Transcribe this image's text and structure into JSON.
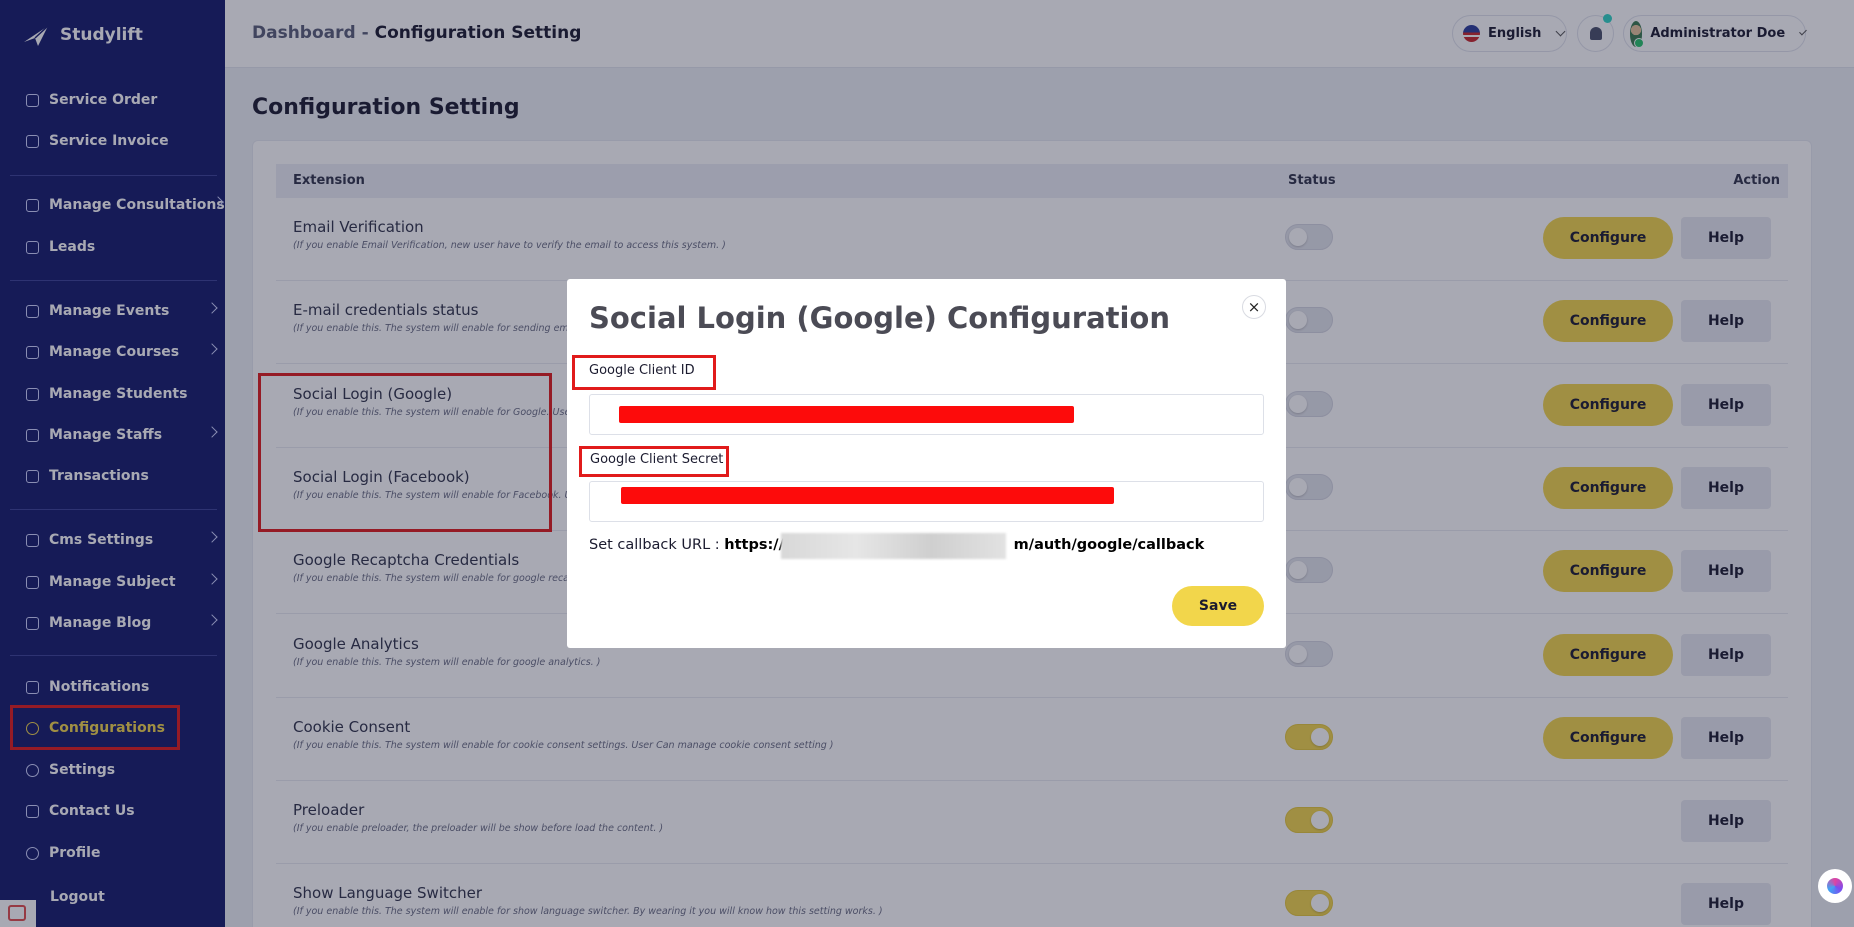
{
  "brand": {
    "name": "Studylift"
  },
  "sidebar": {
    "items": [
      {
        "label": "Service Order",
        "icon": "list-icon"
      },
      {
        "label": "Service Invoice",
        "icon": "invoice-icon"
      },
      {
        "label": "Manage Consultations",
        "icon": "consultation-icon"
      },
      {
        "label": "Leads",
        "icon": "leads-icon"
      },
      {
        "label": "Manage Events",
        "icon": "calendar-icon"
      },
      {
        "label": "Manage Courses",
        "icon": "course-icon"
      },
      {
        "label": "Manage Students",
        "icon": "students-icon"
      },
      {
        "label": "Manage Staffs",
        "icon": "staff-icon"
      },
      {
        "label": "Transactions",
        "icon": "transactions-icon"
      },
      {
        "label": "Cms Settings",
        "icon": "cms-icon"
      },
      {
        "label": "Manage Subject",
        "icon": "subject-icon"
      },
      {
        "label": "Manage Blog",
        "icon": "blog-icon"
      },
      {
        "label": "Notifications",
        "icon": "bell-icon"
      },
      {
        "label": "Configurations",
        "icon": "config-icon"
      },
      {
        "label": "Settings",
        "icon": "gear-icon"
      },
      {
        "label": "Contact Us",
        "icon": "contact-icon"
      },
      {
        "label": "Profile",
        "icon": "user-icon"
      },
      {
        "label": "Logout",
        "icon": "logout-icon"
      }
    ]
  },
  "topbar": {
    "breadcrumb_root": "Dashboard",
    "breadcrumb_sep": "-",
    "breadcrumb_current": "Configuration Setting",
    "language": "English",
    "user_name": "Administrator Doe"
  },
  "page": {
    "title": "Configuration Setting"
  },
  "table": {
    "columns": {
      "extension": "Extension",
      "status": "Status",
      "action": "Action"
    },
    "configure_label": "Configure",
    "help_label": "Help",
    "rows": [
      {
        "title": "Email Verification",
        "desc": "(If you enable Email Verification, new user have to verify the email to access this system. )",
        "status": false,
        "configurable": true
      },
      {
        "title": "E-mail credentials status",
        "desc": "(If you enable this. The system will enable for sending em",
        "status": false,
        "configurable": true
      },
      {
        "title": "Social Login (Google)",
        "desc": "(If you enable this. The system will enable for Google. Use",
        "status": false,
        "configurable": true
      },
      {
        "title": "Social Login (Facebook)",
        "desc": "(If you enable this. The system will enable for Facebook. U",
        "status": false,
        "configurable": true
      },
      {
        "title": "Google Recaptcha Credentials",
        "desc": "(If you enable this. The system will enable for google reca",
        "status": false,
        "configurable": true
      },
      {
        "title": "Google Analytics",
        "desc": "(If you enable this. The system will enable for google analytics. )",
        "status": false,
        "configurable": true
      },
      {
        "title": "Cookie Consent",
        "desc": "(If you enable this. The system will enable for cookie consent settings. User Can manage cookie consent setting )",
        "status": true,
        "configurable": true
      },
      {
        "title": "Preloader",
        "desc": "(If you enable preloader, the preloader will be show before load the content. )",
        "status": true,
        "configurable": false
      },
      {
        "title": "Show Language Switcher",
        "desc": "(If you enable this. The system will enable for show language switcher. By wearing it you will know how this setting works. )",
        "status": true,
        "configurable": false
      }
    ]
  },
  "modal": {
    "title": "Social Login (Google) Configuration",
    "close_symbol": "×",
    "client_id_label": "Google Client ID",
    "client_secret_label": "Google Client Secret",
    "callback_prefix": "Set callback URL :",
    "callback_start": "https://:",
    "callback_end": "m/auth/google/callback",
    "save_label": "Save"
  },
  "colors": {
    "sidebar": "#141b6b",
    "accent": "#f2d64b",
    "highlight": "#e11b1b"
  }
}
